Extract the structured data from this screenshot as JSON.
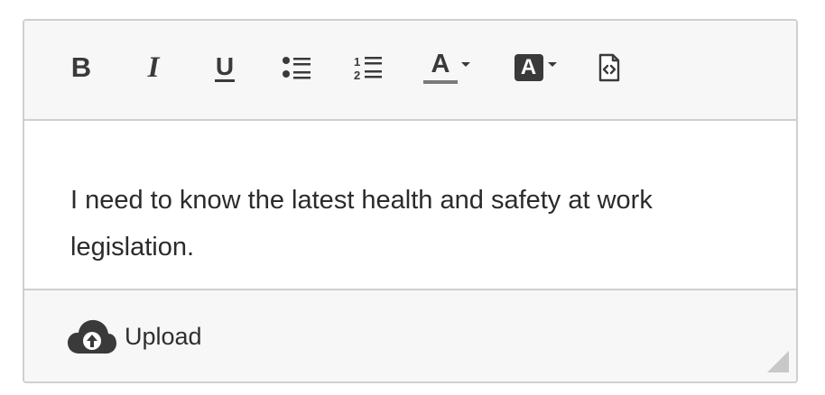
{
  "toolbar": {
    "bold_label": "B",
    "italic_label": "I",
    "underline_label": "U",
    "font_color_label": "A",
    "bg_color_label": "A",
    "icons": {
      "bold": "bold-icon",
      "italic": "italic-icon",
      "underline": "underline-icon",
      "bullet_list": "bullet-list-icon",
      "numbered_list": "numbered-list-icon",
      "font_color": "font-color-icon",
      "background_color": "background-color-icon",
      "source_code": "source-code-icon"
    },
    "numbered_list_digits": [
      "1",
      "2"
    ]
  },
  "content": {
    "text": "I need to know the latest health and safety at work legislation."
  },
  "footer": {
    "upload_label": "Upload",
    "upload_icon": "cloud-upload-icon",
    "resize_icon": "resize-handle-icon"
  },
  "colors": {
    "toolbar_bg": "#f7f7f7",
    "border": "#cfcfcf",
    "icon": "#3a3a3a",
    "text": "#2b2b2b"
  }
}
